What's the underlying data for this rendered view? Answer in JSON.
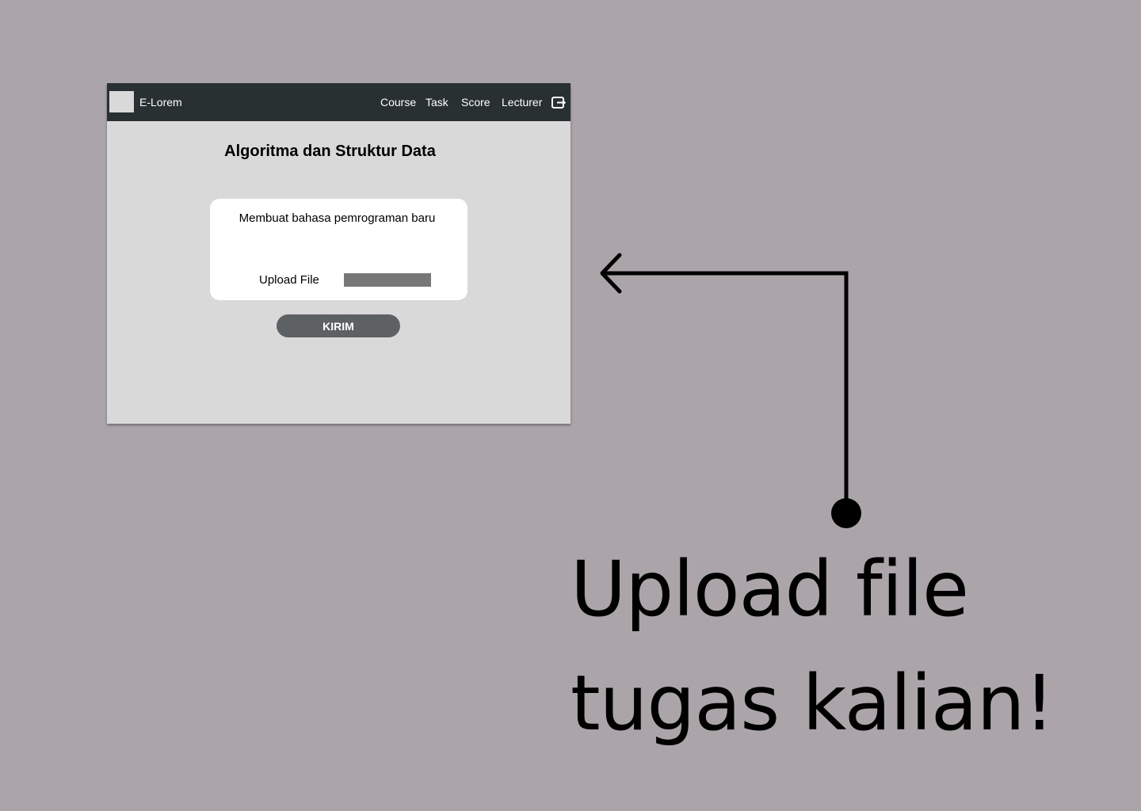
{
  "navbar": {
    "brand": "E-Lorem",
    "items": [
      {
        "label": "Course"
      },
      {
        "label": "Task"
      },
      {
        "label": "Score"
      },
      {
        "label": "Lecturer"
      }
    ],
    "logout_icon": "logout-icon"
  },
  "main": {
    "title": "Algoritma dan Struktur Data",
    "task": {
      "description": "Membuat bahasa pemrograman baru",
      "upload_label": "Upload File"
    },
    "submit_label": "KIRIM"
  },
  "annotation": {
    "line1": "Upload file",
    "line2": "tugas kalian!"
  },
  "colors": {
    "background": "#aba5aa",
    "navbar": "#293032",
    "panel": "#d9d9d9",
    "button": "#5e6163",
    "upload_field": "#777777"
  }
}
